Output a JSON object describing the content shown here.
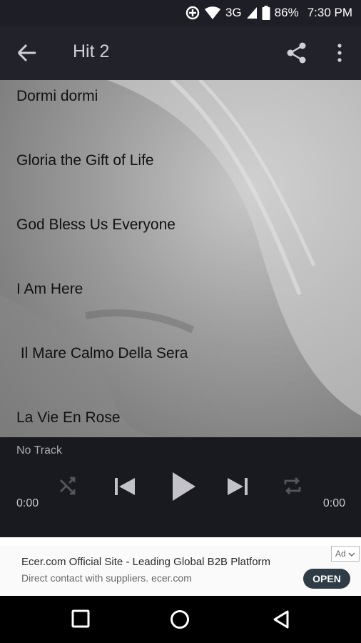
{
  "status_bar": {
    "network": "3G",
    "battery": "86%",
    "time": "7:30 PM",
    "icons": [
      "data-saver-icon",
      "wifi-icon",
      "signal-icon",
      "battery-icon"
    ]
  },
  "app_bar": {
    "title": "Hit 2",
    "icons": [
      "back-arrow-icon",
      "share-icon",
      "more-vert-icon"
    ]
  },
  "tracks": [
    "Dormi dormi",
    "Gloria the Gift of Life",
    "God Bless Us Everyone",
    "I Am Here",
    " Il Mare Calmo Della Sera",
    "La Vie En Rose"
  ],
  "player": {
    "now_playing": "No Track",
    "elapsed": "0:00",
    "duration": "0:00",
    "icons": [
      "shuffle-icon",
      "skip-previous-icon",
      "play-icon",
      "skip-next-icon",
      "repeat-icon"
    ]
  },
  "ad": {
    "headline": "Ecer.com Official Site - Leading Global B2B Platform",
    "subtext": "Direct contact with suppliers. ecer.com",
    "cta": "OPEN",
    "tag": "Ad"
  },
  "nav_bar": {
    "icons": [
      "recents-square-icon",
      "home-circle-icon",
      "back-triangle-icon"
    ]
  },
  "colors": {
    "app_bar": "#22222b",
    "status_bar": "#1e1e26",
    "player": "#1c1c24",
    "open_button": "#2f3c45"
  }
}
